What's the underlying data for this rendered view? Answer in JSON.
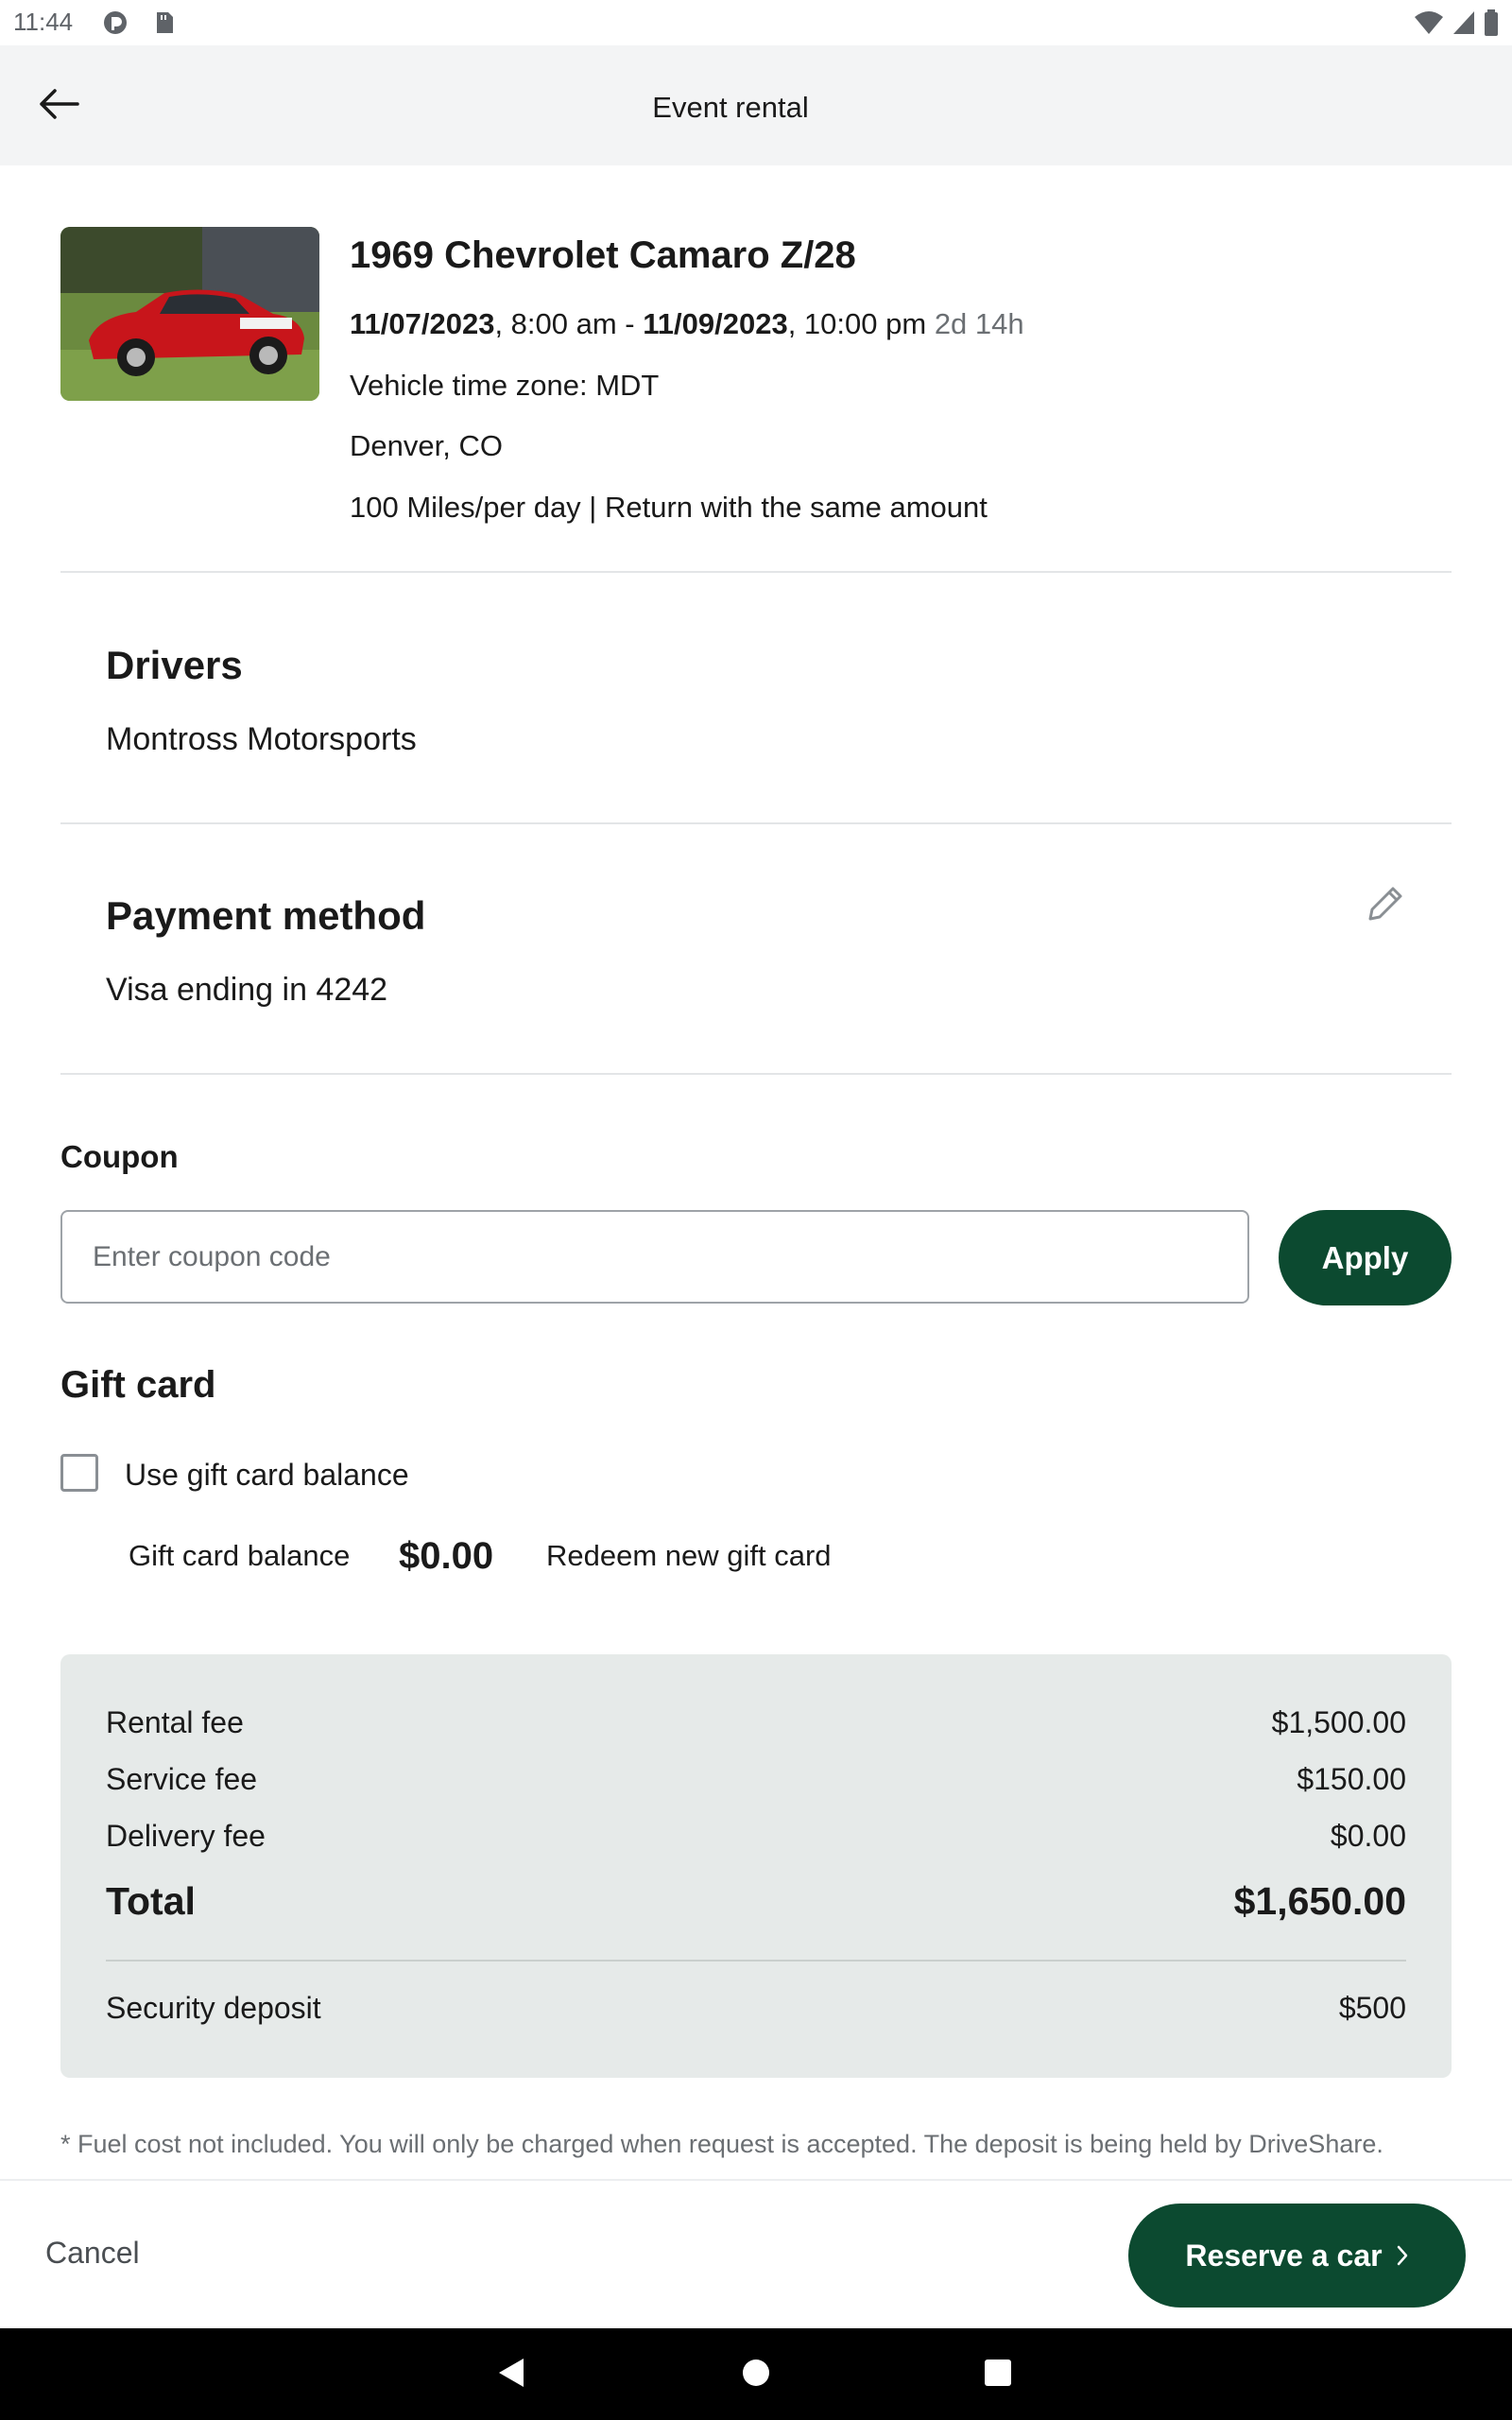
{
  "status_bar": {
    "time": "11:44",
    "icons": [
      "notification-app-icon",
      "sd-card-icon",
      "wifi-icon",
      "signal-icon",
      "battery-icon"
    ]
  },
  "app_bar": {
    "back_icon": "arrow-left-icon",
    "title": "Event rental"
  },
  "car": {
    "photo_icon": "car-photo",
    "title": "1969 Chevrolet Camaro Z/28",
    "start_date": "11/07/2023",
    "start_time": ", 8:00 am - ",
    "end_date": "11/09/2023",
    "end_time": ", 10:00 pm",
    "duration": "2d 14h",
    "time_zone": "Vehicle time zone: MDT",
    "location": "Denver, CO",
    "mileage": "100 Miles/per day | Return with the same amount"
  },
  "drivers": {
    "title": "Drivers",
    "value": "Montross Motorsports"
  },
  "payment": {
    "title": "Payment method",
    "value": "Visa ending in 4242",
    "edit_icon": "pencil-icon"
  },
  "coupon": {
    "title": "Coupon",
    "placeholder": "Enter coupon code",
    "value": "",
    "apply_label": "Apply"
  },
  "gift_card": {
    "title": "Gift card",
    "use_label": "Use gift card balance",
    "use_checked": false,
    "balance_label": "Gift card balance",
    "balance_value": "$0.00",
    "redeem_label": "Redeem new gift card"
  },
  "summary": {
    "rows": [
      {
        "label": "Rental fee",
        "value": "$1,500.00"
      },
      {
        "label": "Service fee",
        "value": "$150.00"
      },
      {
        "label": "Delivery fee",
        "value": "$0.00"
      }
    ],
    "total_label": "Total",
    "total_value": "$1,650.00",
    "deposit_label": "Security deposit",
    "deposit_value": "$500"
  },
  "footnote": "* Fuel cost not included. You will only be charged when request is accepted. The deposit is being held by DriveShare.",
  "bottom_bar": {
    "cancel_label": "Cancel",
    "reserve_label": "Reserve a car",
    "reserve_icon": "chevron-right-icon"
  },
  "colors": {
    "accent": "#0c4a30",
    "summary_bg": "#e6eae9",
    "appbar_bg": "#f3f4f5"
  }
}
